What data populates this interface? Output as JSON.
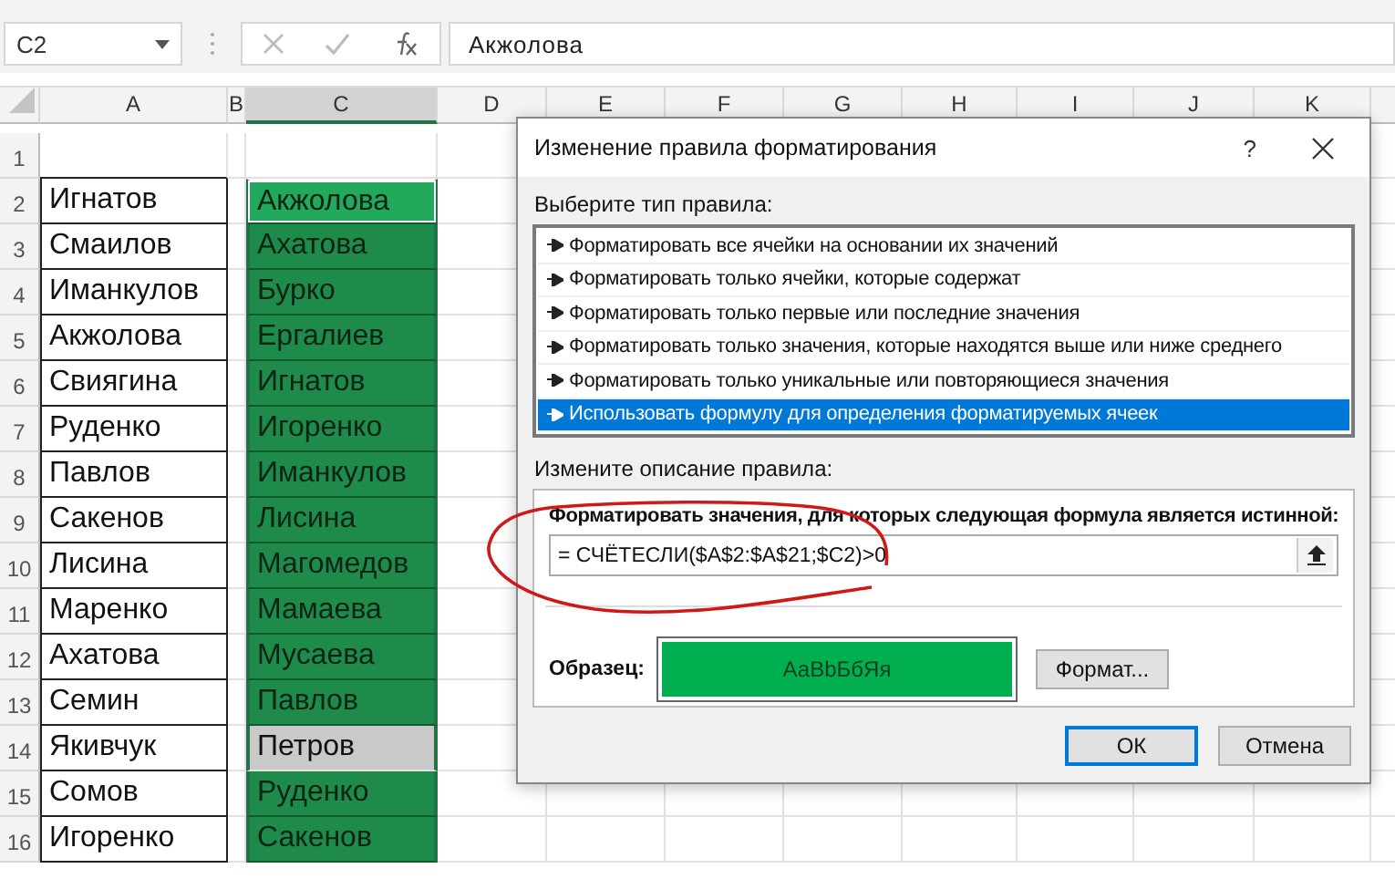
{
  "formula_bar": {
    "name_box": "C2",
    "value": "Акжолова"
  },
  "columns": [
    {
      "label": "A",
      "selected": false
    },
    {
      "label": "B",
      "selected": false
    },
    {
      "label": "C",
      "selected": true
    },
    {
      "label": "D",
      "selected": false
    },
    {
      "label": "E",
      "selected": false
    },
    {
      "label": "F",
      "selected": false
    },
    {
      "label": "G",
      "selected": false
    },
    {
      "label": "H",
      "selected": false
    },
    {
      "label": "I",
      "selected": false
    },
    {
      "label": "J",
      "selected": false
    },
    {
      "label": "K",
      "selected": false
    }
  ],
  "rows": [
    {
      "number": "1"
    },
    {
      "number": "2",
      "a": "Игнатов",
      "c": "Акжолова",
      "highlighted": true,
      "selected": true
    },
    {
      "number": "3",
      "a": "Смаилов",
      "c": "Ахатова",
      "highlighted": true,
      "selected": false
    },
    {
      "number": "4",
      "a": "Иманкулов",
      "c": "Бурко",
      "highlighted": true,
      "selected": false
    },
    {
      "number": "5",
      "a": "Акжолова",
      "c": "Ергалиев",
      "highlighted": true,
      "selected": false
    },
    {
      "number": "6",
      "a": "Свиягина",
      "c": "Игнатов",
      "highlighted": true,
      "selected": false
    },
    {
      "number": "7",
      "a": "Руденко",
      "c": "Игоренко",
      "highlighted": true,
      "selected": false
    },
    {
      "number": "8",
      "a": "Павлов",
      "c": "Иманкулов",
      "highlighted": true,
      "selected": false
    },
    {
      "number": "9",
      "a": "Сакенов",
      "c": "Лисина",
      "highlighted": true,
      "selected": false
    },
    {
      "number": "10",
      "a": "Лисина",
      "c": "Магомедов",
      "highlighted": true,
      "selected": false
    },
    {
      "number": "11",
      "a": "Маренко",
      "c": "Мамаева",
      "highlighted": true,
      "selected": false
    },
    {
      "number": "12",
      "a": "Ахатова",
      "c": "Мусаева",
      "highlighted": true,
      "selected": false
    },
    {
      "number": "13",
      "a": "Семин",
      "c": "Павлов",
      "highlighted": true,
      "selected": false
    },
    {
      "number": "14",
      "a": "Якивчук",
      "c": "Петров",
      "highlighted": false,
      "selected": false
    },
    {
      "number": "15",
      "a": "Сомов",
      "c": "Руденко",
      "highlighted": true,
      "selected": false
    },
    {
      "number": "16",
      "a": "Игоренко",
      "c": "Сакенов",
      "highlighted": true,
      "selected": false
    }
  ],
  "dialog": {
    "title": "Изменение правила форматирования",
    "help": "?",
    "rule_type_label": "Выберите тип правила:",
    "rule_types": [
      {
        "label": "Форматировать все ячейки на основании их значений",
        "selected": false
      },
      {
        "label": "Форматировать только ячейки, которые содержат",
        "selected": false
      },
      {
        "label": "Форматировать только первые или последние значения",
        "selected": false
      },
      {
        "label": "Форматировать только значения, которые находятся выше или ниже среднего",
        "selected": false
      },
      {
        "label": "Форматировать только уникальные или повторяющиеся значения",
        "selected": false
      },
      {
        "label": "Использовать формулу для определения форматируемых ячеек",
        "selected": true
      }
    ],
    "description_label": "Измените описание правила:",
    "formula_label": "Форматировать значения, для которых следующая формула является истинной:",
    "formula": "= СЧЁТЕСЛИ($A$2:$A$21;$C2)>0",
    "sample_label": "Образец:",
    "sample_text": "АаBbБбЯя",
    "format_button": "Формат...",
    "ok": "ОК",
    "cancel": "Отмена"
  }
}
